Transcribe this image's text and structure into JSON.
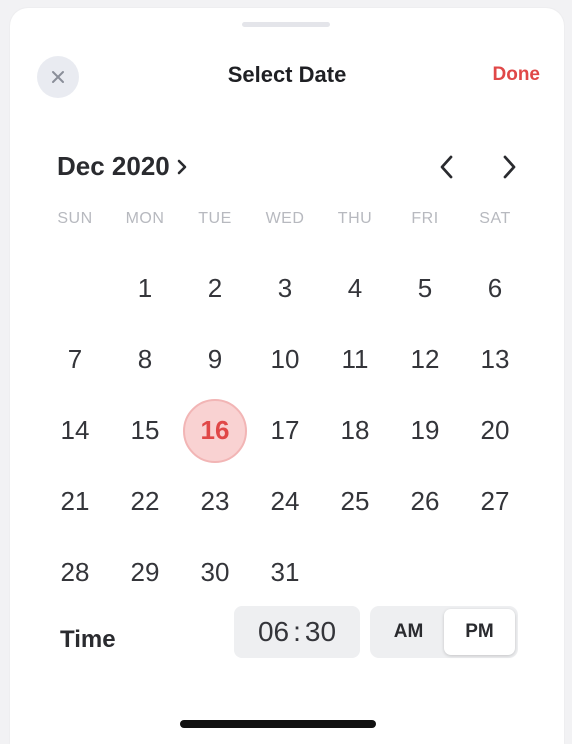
{
  "header": {
    "title": "Select Date",
    "done_label": "Done",
    "close_icon": "close-icon"
  },
  "calendar": {
    "month_label": "Dec 2020",
    "weekdays": [
      "SUN",
      "MON",
      "TUE",
      "WED",
      "THU",
      "FRI",
      "SAT"
    ],
    "days": [
      "",
      "1",
      "2",
      "3",
      "4",
      "5",
      "6",
      "7",
      "8",
      "9",
      "10",
      "11",
      "12",
      "13",
      "14",
      "15",
      "16",
      "17",
      "18",
      "19",
      "20",
      "21",
      "22",
      "23",
      "24",
      "25",
      "26",
      "27",
      "28",
      "29",
      "30",
      "31"
    ],
    "selected_day": "16"
  },
  "time": {
    "label": "Time",
    "hours": "06",
    "separator": ":",
    "minutes": "30",
    "am_label": "AM",
    "pm_label": "PM",
    "active_period": "PM"
  },
  "colors": {
    "accent": "#e04848",
    "selected_bg": "#f9d2d2"
  }
}
